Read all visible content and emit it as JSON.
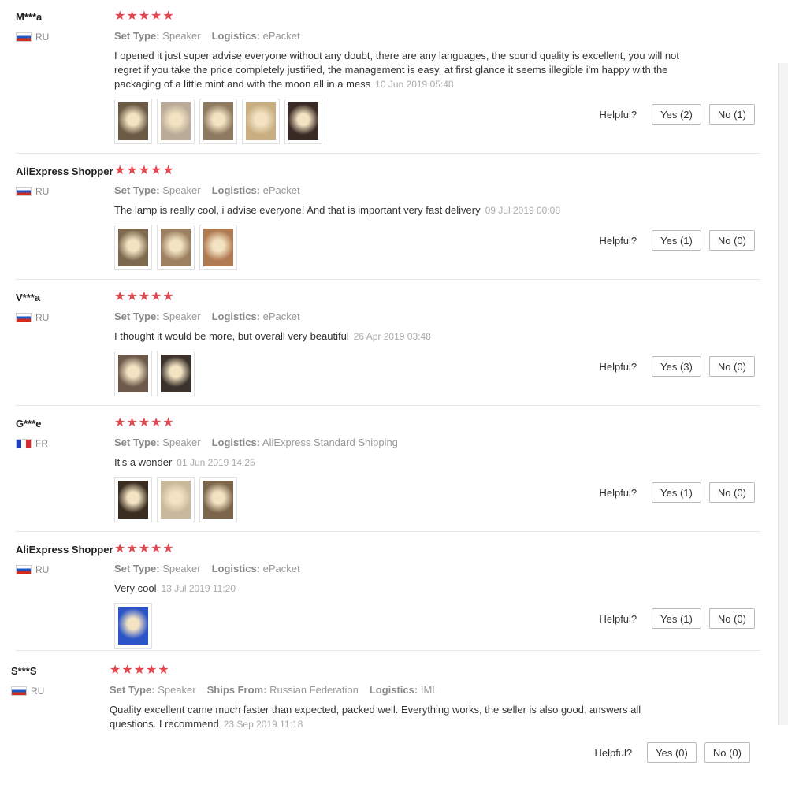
{
  "helpful_label": "Helpful?",
  "colors": {
    "star": "#e5474f",
    "divider": "#e8e8e8",
    "muted": "#999999"
  },
  "reviews": [
    {
      "user": "M***a",
      "country": "RU",
      "flag": "ru-flag-icon",
      "stars": "★★★★★",
      "attributes": [
        {
          "key": "Set Type:",
          "value": "Speaker"
        },
        {
          "key": "Logistics:",
          "value": "ePacket"
        }
      ],
      "text": "I opened it just super advise everyone without any doubt, there are any languages, the sound quality is excellent, you will not regret if you take the price completely justified, the management is easy, at first glance it seems illegible i'm happy with the packaging of a little mint and with the moon all in a mess",
      "date": "10 Jun 2019 05:48",
      "photos": [
        {
          "color": "#6b5a44"
        },
        {
          "color": "#b9ab98"
        },
        {
          "color": "#8e7a60"
        },
        {
          "color": "#c9ae82"
        },
        {
          "color": "#3a2a25"
        }
      ],
      "yes": "Yes (2)",
      "no": "No (1)"
    },
    {
      "user": "AliExpress Shopper",
      "country": "RU",
      "flag": "ru-flag-icon",
      "stars": "★★★★★",
      "attributes": [
        {
          "key": "Set Type:",
          "value": "Speaker"
        },
        {
          "key": "Logistics:",
          "value": "ePacket"
        }
      ],
      "text": "The lamp is really cool, i advise everyone! And that is important very fast delivery",
      "date": "09 Jul 2019 00:08",
      "photos": [
        {
          "color": "#7d6a4e"
        },
        {
          "color": "#9c8060"
        },
        {
          "color": "#b07a52"
        }
      ],
      "yes": "Yes (1)",
      "no": "No (0)"
    },
    {
      "user": "V***a",
      "country": "RU",
      "flag": "ru-flag-icon",
      "stars": "★★★★★",
      "attributes": [
        {
          "key": "Set Type:",
          "value": "Speaker"
        },
        {
          "key": "Logistics:",
          "value": "ePacket"
        }
      ],
      "text": "I thought it would be more, but overall very beautiful",
      "date": "26 Apr 2019 03:48",
      "photos": [
        {
          "color": "#6e5a4c"
        },
        {
          "color": "#3b322c"
        }
      ],
      "yes": "Yes (3)",
      "no": "No (0)"
    },
    {
      "user": "G***e",
      "country": "FR",
      "flag": "fr-flag-icon",
      "stars": "★★★★★",
      "attributes": [
        {
          "key": "Set Type:",
          "value": "Speaker"
        },
        {
          "key": "Logistics:",
          "value": "AliExpress Standard Shipping"
        }
      ],
      "text": "It's a wonder",
      "date": "01 Jun 2019 14:25",
      "photos": [
        {
          "color": "#3a2e22"
        },
        {
          "color": "#c9b89c"
        },
        {
          "color": "#7b664c"
        }
      ],
      "yes": "Yes (1)",
      "no": "No (0)"
    },
    {
      "user": "AliExpress Shopper",
      "country": "RU",
      "flag": "ru-flag-icon",
      "stars": "★★★★★",
      "attributes": [
        {
          "key": "Set Type:",
          "value": "Speaker"
        },
        {
          "key": "Logistics:",
          "value": "ePacket"
        }
      ],
      "text": "Very cool",
      "date": "13 Jul 2019 11:20",
      "photos": [
        {
          "color": "#2b54c8"
        }
      ],
      "yes": "Yes (1)",
      "no": "No (0)"
    },
    {
      "user": "S***S",
      "country": "RU",
      "flag": "ru-flag-icon",
      "stars": "★★★★★",
      "attributes": [
        {
          "key": "Set Type:",
          "value": "Speaker"
        },
        {
          "key": "Ships From:",
          "value": "Russian Federation"
        },
        {
          "key": "Logistics:",
          "value": "IML"
        }
      ],
      "text": "Quality excellent came much faster than expected, packed well. Everything works, the seller is also good, answers all questions. I recommend",
      "date": "23 Sep 2019 11:18",
      "photos": [],
      "yes": "Yes (0)",
      "no": "No (0)"
    }
  ]
}
